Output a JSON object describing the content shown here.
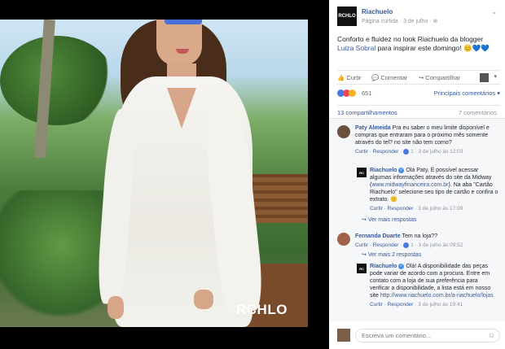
{
  "photo": {
    "watermark": "RCHLO"
  },
  "post": {
    "page_logo": "RCHLO",
    "page_name": "Riachuelo",
    "meta": "Página curtida · 3 de julho · ⊕",
    "text_before": "Conforto e fluidez no look Riachuelo da blogger ",
    "text_link": "Luiza Sobral",
    "text_after": " para inspirar este domingo! 😊💙💙"
  },
  "actions": {
    "like": "Curtir",
    "comment": "Comentar",
    "share": "Compartilhar"
  },
  "reactions": {
    "count": "651",
    "top_comments": "Principais comentários ▾"
  },
  "stats": {
    "shares": "13 compartilhamentos",
    "comments": "7 comentários"
  },
  "comments": [
    {
      "author": "Paty Almeida",
      "text": " Pra eu saber o meu limite disponível e compras que entraram para o próximo mês somente através do tel? no site não tem como?",
      "meta_actions": "Curtir · Responder",
      "likes": "1",
      "date": "3 de julho às 12:03"
    },
    {
      "author": "Riachuelo",
      "text": " Olá Paty, É possível acessar algumas informações através do site da Midway (",
      "link": "www.midwayfinanceira.com.br",
      "text_after": "). Na aba \"Cartão Riachuelo\" selecione seu tipo de cartão e confira o extrato. 🙂",
      "meta_actions": "Curtir · Responder",
      "date": "3 de julho às 17:09",
      "more": "Ver mais respostas"
    },
    {
      "author": "Fernanda Duarte",
      "text": " Tem na loja??",
      "meta_actions": "Curtir · Responder",
      "likes": "1",
      "date": "3 de julho às 09:52",
      "more": "Ver mais 2 respostas"
    },
    {
      "author": "Riachuelo",
      "text": " Olá! A disponibilidade das peças pode variar de acordo com a procura. Entre em contato com a loja de sua preferência para verificar a disponibilidade, a lista está em nosso site ",
      "link": "http://www.riachuelo.com.br/a-riachuelo/lojas",
      "meta_actions": "Curtir · Responder",
      "date": "3 de julho às 19:41"
    }
  ],
  "composer": {
    "placeholder": "Escreva um comentário..."
  },
  "colors": {
    "link": "#365899",
    "meta": "#90949c",
    "background": "#000000",
    "panel": "#ffffff"
  }
}
